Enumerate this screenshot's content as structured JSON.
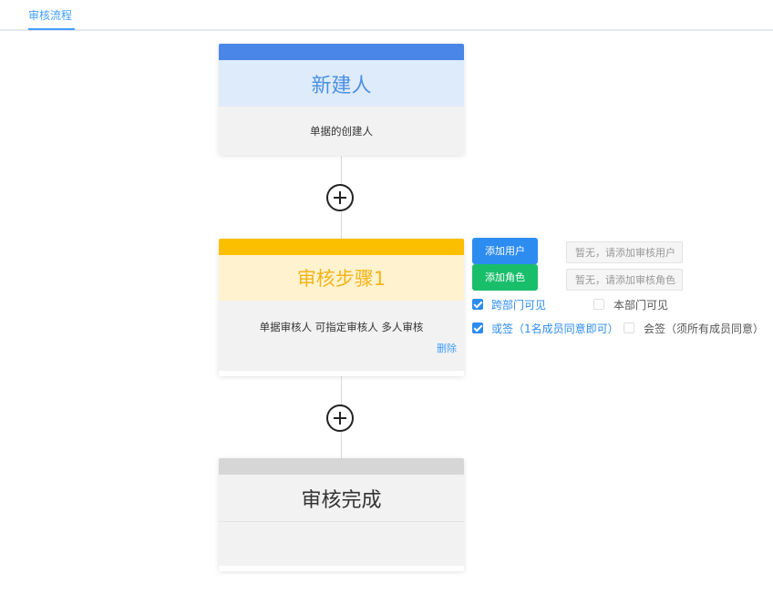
{
  "tabs": {
    "active_label": "审核流程"
  },
  "nodes": {
    "creator": {
      "title": "新建人",
      "desc": "单据的创建人"
    },
    "step1": {
      "title": "审核步骤1",
      "desc": "单据审核人 可指定审核人 多人审核",
      "delete_label": "删除"
    },
    "done": {
      "title": "审核完成"
    }
  },
  "panel": {
    "add_user_label": "添加用户",
    "add_role_label": "添加角色",
    "user_placeholder": "暂无，请添加审核用户",
    "role_placeholder": "暂无，请添加审核角色",
    "options": {
      "cross_dept": {
        "label": "跨部门可见",
        "checked": true
      },
      "own_dept": {
        "label": "本部门可见",
        "checked": false
      },
      "or_sign": {
        "label": "或签（1名成员同意即可）",
        "checked": true
      },
      "joint_sign": {
        "label": "会签（须所有成员同意）",
        "checked": false
      }
    }
  },
  "colors": {
    "accent": "#409eff",
    "creator_strip": "#4a86e8",
    "creator_head_bg": "#deebfb",
    "step_strip": "#fbbf00",
    "step_head_bg": "#fff3cf",
    "done_strip": "#d6d6d6",
    "btn_blue": "#2d8cf0",
    "btn_green": "#19be6b"
  }
}
